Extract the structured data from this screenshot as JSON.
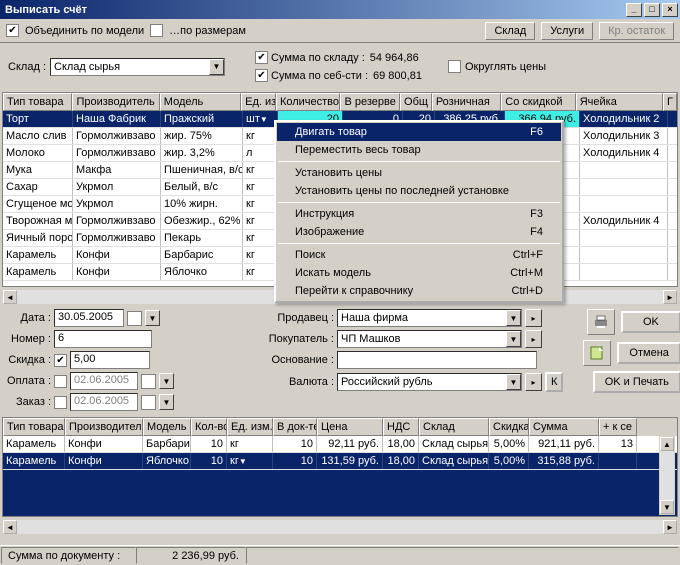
{
  "title": "Выписать счёт",
  "toolbar": {
    "merge_by_model": "Объединить по модели",
    "by_sizes": "…по размерам",
    "sklad_tab": "Склад",
    "uslugi_tab": "Услуги",
    "kr_ostatok": "Кр. остаток"
  },
  "wh": {
    "label": "Склад :",
    "value": "Склад сырья",
    "sum_sklad_lbl": "Сумма по складу :",
    "sum_sklad_val": "54 964,86",
    "sum_seb_lbl": "Сумма по себ-сти :",
    "sum_seb_val": "69 800,81",
    "round": "Округлять цены"
  },
  "grid1": {
    "headers": [
      "Тип товара",
      "Производитель",
      "Модель",
      "Ед. изм",
      "Количество",
      "В резерве",
      "Общ",
      "Розничная",
      "Со скидкой",
      "Ячейка"
    ],
    "rows": [
      {
        "sel": true,
        "c": [
          "Торт",
          "Наша Фабрик",
          "Пражский",
          "шт",
          "20",
          "0",
          "20",
          "386,25 руб.",
          "366,94 руб.",
          "Холодильник 2"
        ]
      },
      {
        "c": [
          "Масло слив",
          "Гормолживзаво",
          "жир. 75%",
          "кг",
          "",
          "",
          "",
          "",
          "",
          "Холодильник 3"
        ]
      },
      {
        "c": [
          "Молоко",
          "Гормолживзаво",
          "жир. 3,2%",
          "л",
          "",
          "",
          "",
          "",
          "",
          "Холодильник 4"
        ]
      },
      {
        "c": [
          "Мука",
          "Макфа",
          "Пшеничная, в/с",
          "кг",
          "",
          "",
          "",
          "",
          "",
          ""
        ]
      },
      {
        "c": [
          "Сахар",
          "Укрмол",
          "Белый, в/с",
          "кг",
          "",
          "",
          "",
          "",
          "",
          ""
        ]
      },
      {
        "c": [
          "Сгущеное мо",
          "Укрмол",
          "10% жирн.",
          "кг",
          "",
          "",
          "",
          "",
          "",
          ""
        ]
      },
      {
        "c": [
          "Творожная ма",
          "Гормолживзаво",
          "Обезжир., 62%",
          "кг",
          "",
          "",
          "",
          "",
          "",
          "Холодильник 4"
        ]
      },
      {
        "c": [
          "Яичный поро",
          "Гормолживзаво",
          "Пекарь",
          "кг",
          "",
          "",
          "",
          "",
          "",
          ""
        ]
      },
      {
        "c": [
          "Карамель",
          "Конфи",
          "Барбарис",
          "кг",
          "",
          "",
          "",
          "",
          "",
          ""
        ]
      },
      {
        "c": [
          "Карамель",
          "Конфи",
          "Яблочко",
          "кг",
          "",
          "",
          "",
          "",
          "",
          ""
        ]
      }
    ]
  },
  "ctx": {
    "items": [
      {
        "l": "Двигать товар",
        "s": "F6",
        "sel": true
      },
      {
        "l": "Переместить весь товар"
      },
      {
        "sep": true
      },
      {
        "l": "Установить цены"
      },
      {
        "l": "Установить цены по последней установке"
      },
      {
        "sep": true
      },
      {
        "l": "Инструкция",
        "s": "F3"
      },
      {
        "l": "Изображение",
        "s": "F4"
      },
      {
        "sep": true
      },
      {
        "l": "Поиск",
        "s": "Ctrl+F"
      },
      {
        "l": "Искать модель",
        "s": "Ctrl+M"
      },
      {
        "l": "Перейти к справочнику",
        "s": "Ctrl+D"
      }
    ]
  },
  "form": {
    "date_l": "Дата :",
    "date_v": "30.05.2005",
    "nomer_l": "Номер :",
    "nomer_v": "6",
    "skidka_l": "Скидка :",
    "skidka_v": "5,00",
    "oplata_l": "Оплата :",
    "oplata_v": "02.06.2005",
    "zakaz_l": "Заказ :",
    "zakaz_v": "02.06.2005",
    "prodavec_l": "Продавец :",
    "prodavec_v": "Наша фирма",
    "pokup_l": "Покупатель :",
    "pokup_v": "ЧП Машков",
    "osnov_l": "Основание :",
    "osnov_v": "",
    "valuta_l": "Валюта :",
    "valuta_v": "Российский рубль",
    "k_btn": "К",
    "ok": "OK",
    "cancel": "Отмена",
    "okprint": "OK и Печать"
  },
  "grid2": {
    "headers": [
      "Тип товара",
      "Производитель",
      "Модель",
      "Кол-во",
      "Ед. изм.",
      "В док-те",
      "Цена",
      "НДС",
      "Склад",
      "Скидка",
      "Сумма",
      "+ к се"
    ],
    "rows": [
      {
        "c": [
          "Карамель",
          "Конфи",
          "Барбарис",
          "10",
          "кг",
          "10",
          "92,11 руб.",
          "18,00",
          "Склад сырья",
          "5,00%",
          "921,11 руб.",
          "13"
        ]
      },
      {
        "sel": true,
        "c": [
          "Карамель",
          "Конфи",
          "Яблочко",
          "10",
          "кг",
          "10",
          "131,59 руб.",
          "18,00",
          "Склад сырья",
          "5,00%",
          "315,88 руб.",
          ""
        ]
      }
    ]
  },
  "status": {
    "l": "Сумма по документу :",
    "v": "2 236,99 руб."
  }
}
